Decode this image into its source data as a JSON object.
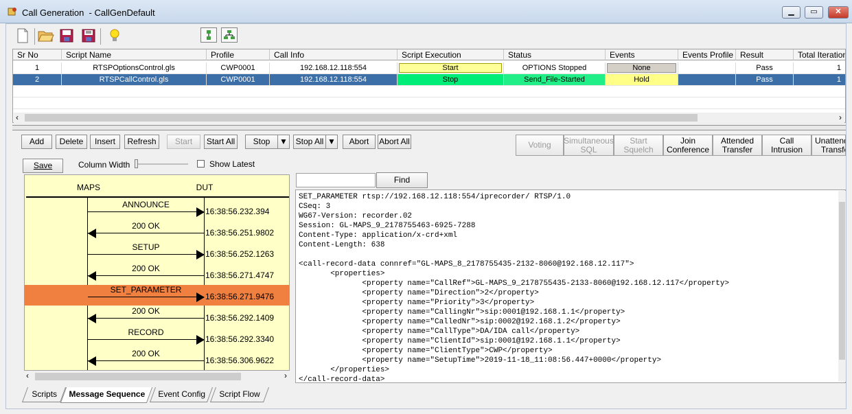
{
  "window": {
    "title": "Call Generation  - CallGenDefault",
    "min_label": "▁",
    "max_label": "▭",
    "close_label": "✕"
  },
  "toolbar": {
    "icons": [
      "new-file-icon",
      "open-folder-icon",
      "save-icon",
      "save-as-icon",
      "lightbulb-icon",
      "tile-vertical-icon",
      "tree-view-icon"
    ]
  },
  "grid": {
    "headers": [
      "Sr No",
      "Script Name",
      "Profile",
      "Call Info",
      "Script Execution",
      "Status",
      "Events",
      "Events Profile",
      "Result",
      "Total Iterations"
    ],
    "rows": [
      {
        "srno": "1",
        "script": "RTSPOptionsControl.gls",
        "profile": "CWP0001",
        "callinfo": "192.168.12.118:554",
        "exec": "Start",
        "status": "OPTIONS Stopped",
        "events": "None",
        "events_profile": "",
        "result": "Pass",
        "iterations": "1"
      },
      {
        "srno": "2",
        "script": "RTSPCallControl.gls",
        "profile": "CWP0001",
        "callinfo": "192.168.12.118:554",
        "exec": "Stop",
        "status": "Send_File-Started",
        "events": "Hold",
        "events_profile": "",
        "result": "Pass",
        "iterations": "1"
      }
    ]
  },
  "buttons": {
    "add": "Add",
    "delete": "Delete",
    "insert": "Insert",
    "refresh": "Refresh",
    "start": "Start",
    "start_all": "Start All",
    "stop": "Stop",
    "stop_all": "Stop All",
    "abort": "Abort",
    "abort_all": "Abort All"
  },
  "feature_buttons": {
    "voting": "Voting",
    "simul": "Simultaneous\nSQL",
    "squelch": "Start Squelch",
    "join": "Join\nConference",
    "attended": "Attended\nTransfer",
    "intrusion": "Call Intrusion",
    "unattended": "Unattended\nTransfer"
  },
  "sequence_controls": {
    "save": "Save",
    "column_width": "Column Width",
    "show_latest": "Show Latest"
  },
  "sequence": {
    "left_label": "MAPS",
    "right_label": "DUT",
    "messages": [
      {
        "name": "ANNOUNCE",
        "time": "16:38:56.232.394",
        "dir": "right"
      },
      {
        "name": "200 OK",
        "time": "16:38:56.251.9802",
        "dir": "left"
      },
      {
        "name": "SETUP",
        "time": "16:38:56.252.1263",
        "dir": "right"
      },
      {
        "name": "200 OK",
        "time": "16:38:56.271.4747",
        "dir": "left"
      },
      {
        "name": "SET_PARAMETER",
        "time": "16:38:56.271.9476",
        "dir": "right",
        "highlight": true
      },
      {
        "name": "200 OK",
        "time": "16:38:56.292.1409",
        "dir": "left"
      },
      {
        "name": "RECORD",
        "time": "16:38:56.292.3340",
        "dir": "right"
      },
      {
        "name": "200 OK",
        "time": "16:38:56.306.9622",
        "dir": "left"
      }
    ]
  },
  "find": {
    "value": "",
    "label": "Find"
  },
  "message_lines": [
    "SET_PARAMETER rtsp://192.168.12.118:554/iprecorder/ RTSP/1.0",
    "CSeq: 3",
    "WG67-Version: recorder.02",
    "Session: GL-MAPS_9_2178755463-6925-7288",
    "Content-Type: application/x-crd+xml",
    "Content-Length: 638",
    "",
    "<call-record-data connref=\"GL-MAPS_8_2178755435-2132-8060@192.168.12.117\">",
    "       <properties>",
    "              <property name=\"CallRef\">GL-MAPS_9_2178755435-2133-8060@192.168.12.117</property>",
    "              <property name=\"Direction\">2</property>",
    "              <property name=\"Priority\">3</property>",
    "              <property name=\"CallingNr\">sip:0001@192.168.1.1</property>",
    "              <property name=\"CalledNr\">sip:0002@192.168.1.2</property>",
    "              <property name=\"CallType\">DA/IDA call</property>",
    "              <property name=\"ClientId\">sip:0001@192.168.1.1</property>",
    "              <property name=\"ClientType\">CWP</property>",
    "              <property name=\"SetupTime\">2019-11-18_11:08:56.447+0000</property>",
    "       </properties>",
    "</call-record-data>"
  ],
  "tabs": [
    "Scripts",
    "Message Sequence",
    "Event Config",
    "Script Flow"
  ],
  "colors": {
    "start_yellow": "#ffff99",
    "stop_green": "#00ee77",
    "status_yellow": "#ffffaa",
    "status_green": "#22ee88",
    "none_gray": "#d4d0c8",
    "hold_yellow": "#ffff88",
    "seq_bg": "#ffffc8",
    "highlight": "#f08040",
    "selection": "#3c6fa7"
  }
}
